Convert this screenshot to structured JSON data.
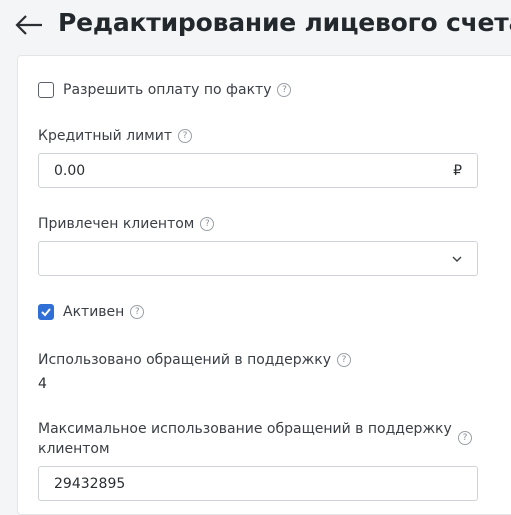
{
  "header": {
    "back_icon": "arrow-left-icon",
    "title": "Редактирование лицевого счета -"
  },
  "form": {
    "allow_pay_on_fact": {
      "label": "Разрешить оплату по факту",
      "checked": false
    },
    "credit_limit": {
      "label": "Кредитный лимит",
      "value": "0.00",
      "currency": "₽"
    },
    "referred_by": {
      "label": "Привлечен клиентом",
      "value": ""
    },
    "active": {
      "label": "Активен",
      "checked": true
    },
    "support_used": {
      "label": "Использовано обращений в поддержку",
      "value": "4"
    },
    "support_max": {
      "label_line1": "Максимальное использование обращений в поддержку",
      "label_line2": "клиентом",
      "value": "29432895"
    },
    "help_glyph": "?"
  },
  "colors": {
    "accent": "#2f6fd6",
    "background": "#f4f5f7",
    "card": "#ffffff"
  }
}
